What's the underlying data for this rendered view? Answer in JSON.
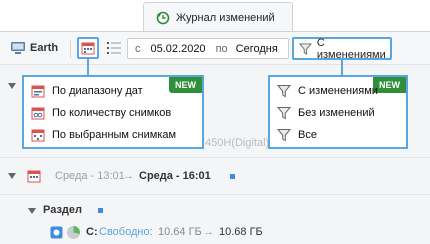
{
  "tab": {
    "title": "Журнал изменений",
    "icon": "history-icon"
  },
  "toolbar": {
    "computer_name": "Earth",
    "date_from_label": "с",
    "date_from": "05.02.2020",
    "date_to_label": "по",
    "date_to": "Сегодня",
    "filter_label": "С изменениями"
  },
  "range_menu": {
    "badge": "NEW",
    "items": [
      {
        "label": "По диапазону дат",
        "icon": "calendar-range-icon"
      },
      {
        "label": "По количеству снимков",
        "icon": "calendar-count-icon"
      },
      {
        "label": "По выбранным снимкам",
        "icon": "calendar-selected-icon"
      }
    ]
  },
  "filter_menu": {
    "badge": "NEW",
    "items": [
      {
        "label": "С изменениями",
        "icon": "filter-icon"
      },
      {
        "label": "Без изменений",
        "icon": "filter-icon"
      },
      {
        "label": "Все",
        "icon": "filter-icon"
      }
    ]
  },
  "list": {
    "partial_text": "450H(Digital)",
    "snapshot_row": {
      "from": "Среда - 13:01",
      "arrow": "→",
      "to": "Среда - 16:01"
    },
    "section_label": "Раздел",
    "disk_row": {
      "drive": "C:",
      "free_label": "Свободно:",
      "before": "10.64 ГБ",
      "arrow": "→",
      "after": "10.68 ГБ"
    }
  },
  "colors": {
    "accent": "#5aa6de",
    "new_badge": "#2f8f3a",
    "link_blue": "#3b8de0"
  }
}
